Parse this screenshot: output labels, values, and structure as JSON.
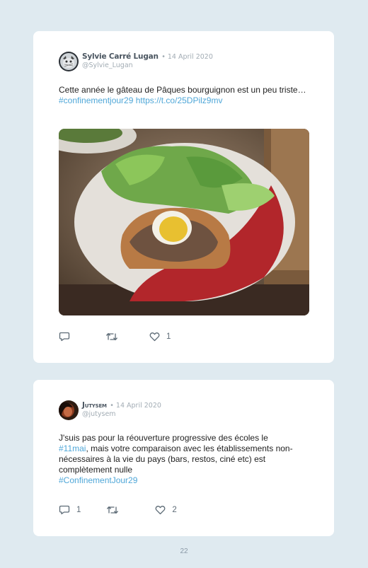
{
  "tweets": [
    {
      "author": "Sylvie Carré Lugan",
      "date": "• 14 April 2020",
      "handle": "@Sylvie_Lugan",
      "text": "Cette année le gâteau de Pâques bourguignon est un peu triste…",
      "hashtag": "#confinementjour29",
      "url": "https://t.co/25DPilz9mv",
      "likes": "1"
    },
    {
      "author": "Jutysem",
      "date": "• 14 April 2020",
      "handle": "@jutysem",
      "text_before": "J'suis pas pour la réouverture progressive des écoles le",
      "hashtag_inline": "#11mai",
      "text_after": ", mais votre comparaison avec les établissements non-nécessaires à la vie du pays (bars, restos, ciné etc) est complètement nulle",
      "hashtag": "#ConfinementJour29",
      "replies": "1",
      "likes": "2"
    }
  ],
  "page_number": "22",
  "colors": {
    "link": "#4fa7d8",
    "background": "#dfeaf0",
    "card": "#ffffff"
  }
}
